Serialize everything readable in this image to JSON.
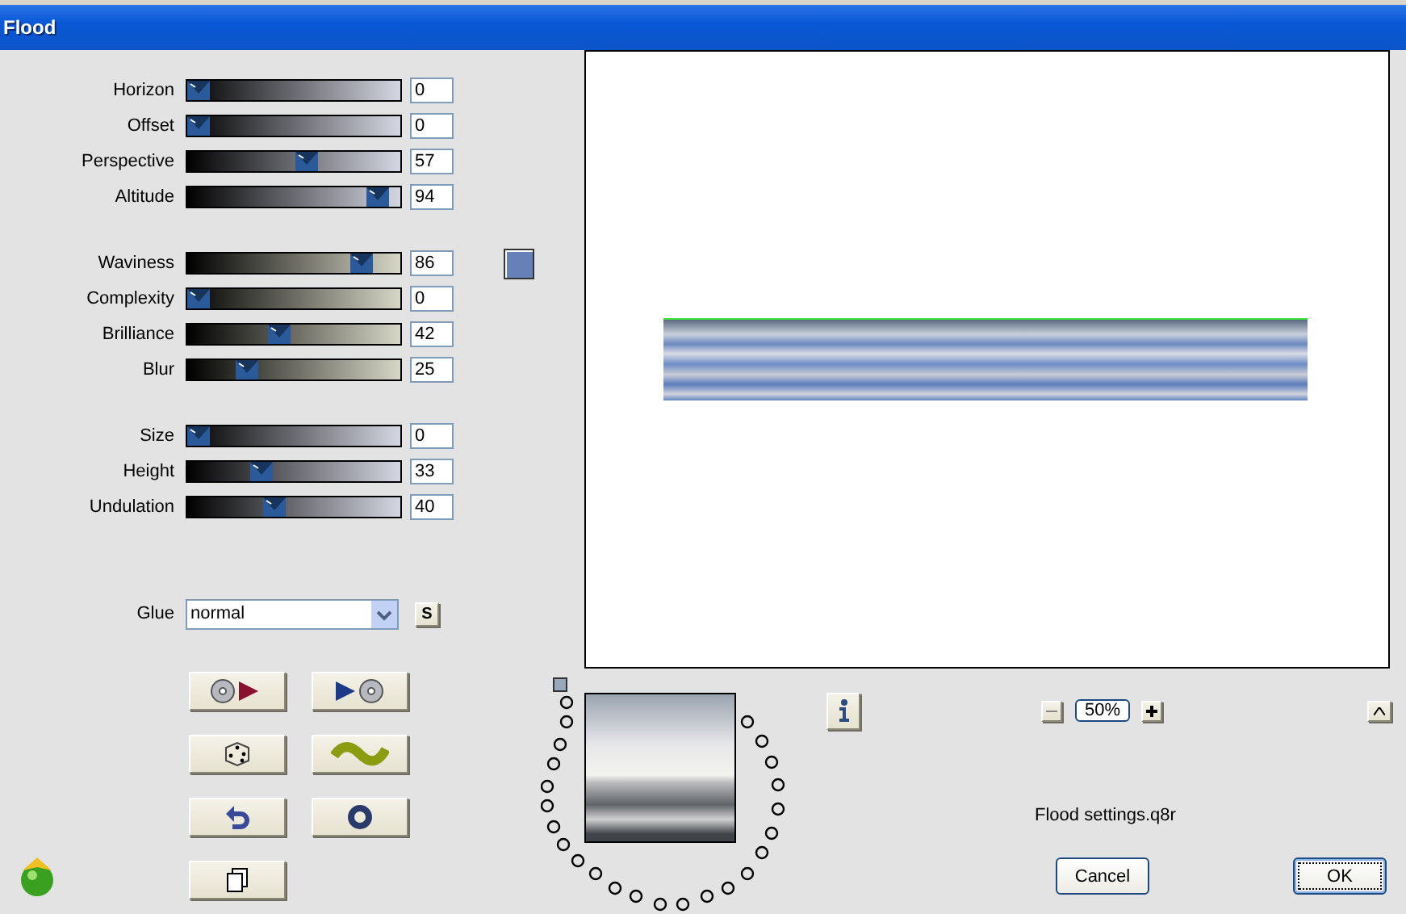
{
  "window": {
    "title": "Flood"
  },
  "groups": [
    {
      "color": "#d4d6e2",
      "sliders": [
        {
          "label": "Horizon",
          "value": "0",
          "level": 0
        },
        {
          "label": "Offset",
          "value": "0",
          "level": 0
        },
        {
          "label": "Perspective",
          "value": "57",
          "level": 0.57
        },
        {
          "label": "Altitude",
          "value": "94",
          "level": 0.94
        }
      ]
    },
    {
      "color": "#d6d6c6",
      "sliders": [
        {
          "label": "Waviness",
          "value": "86",
          "level": 0.86,
          "swatch": {
            "color": "#6680b8"
          }
        },
        {
          "label": "Complexity",
          "value": "0",
          "level": 0
        },
        {
          "label": "Brilliance",
          "value": "42",
          "level": 0.42
        },
        {
          "label": "Blur",
          "value": "25",
          "level": 0.25
        }
      ]
    },
    {
      "color": "#d4d6e2",
      "sliders": [
        {
          "label": "Size",
          "value": "0",
          "level": 0
        },
        {
          "label": "Height",
          "value": "33",
          "level": 0.33
        },
        {
          "label": "Undulation",
          "value": "40",
          "level": 0.4
        }
      ]
    }
  ],
  "glue": {
    "label": "Glue",
    "value": "normal",
    "button": "S"
  },
  "zoom": {
    "value": "50%"
  },
  "settings_file": "Flood settings.q8r",
  "buttons": [
    {
      "label": "Cancel",
      "default": false
    },
    {
      "label": "OK",
      "default": true
    }
  ]
}
